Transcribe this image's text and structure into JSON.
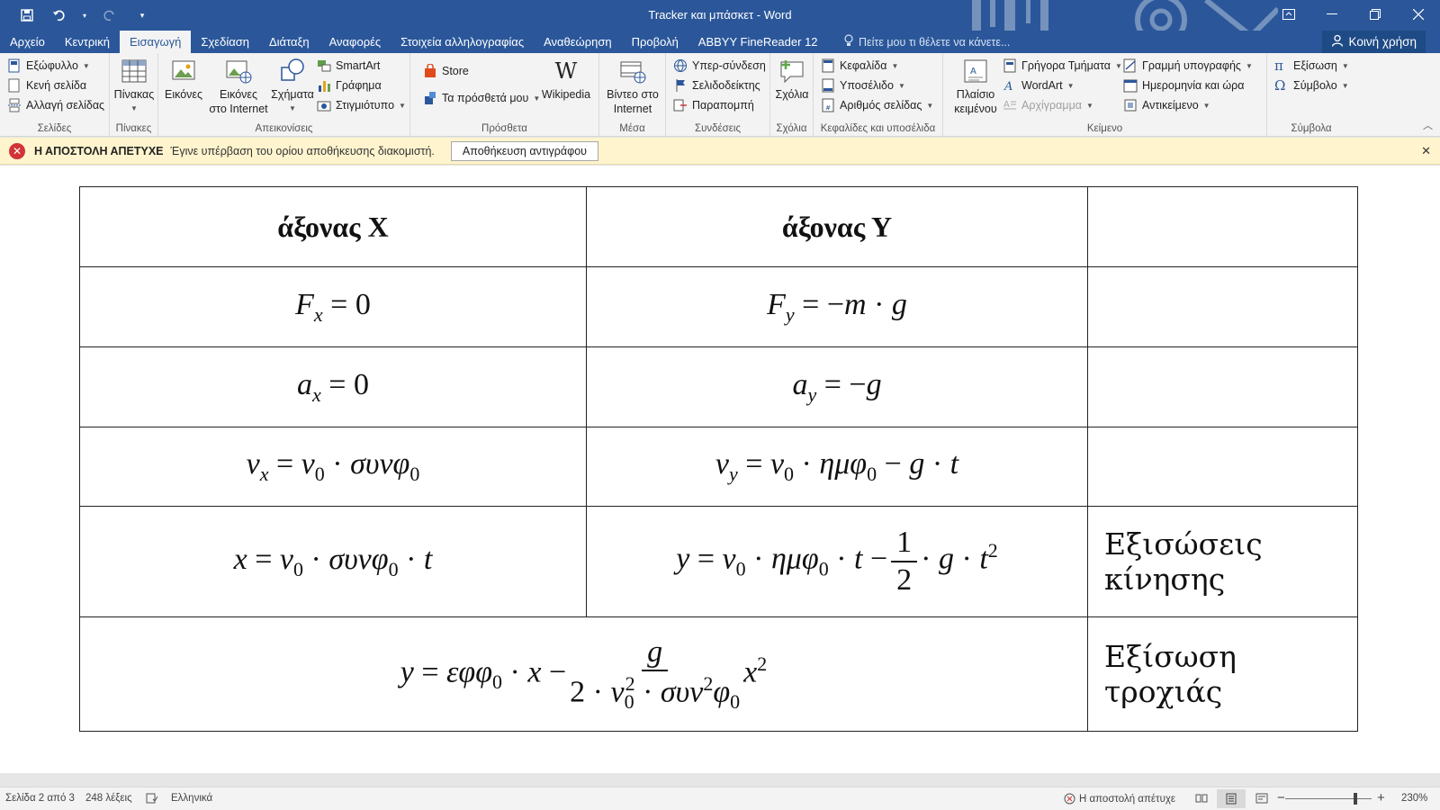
{
  "window": {
    "title": "Tracker και μπάσκετ - Word",
    "qat": [
      "save-icon",
      "undo-icon",
      "redo-icon",
      "customize-icon"
    ],
    "controls": [
      "ribbon-display-icon",
      "minimize-icon",
      "restore-icon",
      "close-icon"
    ]
  },
  "tabs": [
    "Αρχείο",
    "Κεντρική",
    "Εισαγωγή",
    "Σχεδίαση",
    "Διάταξη",
    "Αναφορές",
    "Στοιχεία αλληλογραφίας",
    "Αναθεώρηση",
    "Προβολή",
    "ABBYY FineReader 12"
  ],
  "active_tab": "Εισαγωγή",
  "tell_me": "Πείτε μου τι θέλετε να κάνετε...",
  "share": "Κοινή χρήση",
  "ribbon": {
    "pages": {
      "label": "Σελίδες",
      "items": [
        "Εξώφυλλο",
        "Κενή σελίδα",
        "Αλλαγή σελίδας"
      ]
    },
    "tables": {
      "label": "Πίνακες",
      "item": "Πίνακας"
    },
    "illustrations": {
      "label": "Απεικονίσεις",
      "pictures": "Εικόνες",
      "online_pictures_1": "Εικόνες",
      "online_pictures_2": "στο Internet",
      "shapes": "Σχήματα",
      "smartart": "SmartArt",
      "chart": "Γράφημα",
      "screenshot": "Στιγμιότυπο"
    },
    "addins": {
      "label": "Πρόσθετα",
      "store": "Store",
      "my_addins": "Τα πρόσθετά μου",
      "wikipedia": "Wikipedia"
    },
    "media": {
      "label": "Μέσα",
      "video_1": "Βίντεο στο",
      "video_2": "Internet"
    },
    "links": {
      "label": "Συνδέσεις",
      "items": [
        "Υπερ-σύνδεση",
        "Σελιδοδείκτης",
        "Παραπομπή"
      ]
    },
    "comments": {
      "label": "Σχόλια",
      "item": "Σχόλια"
    },
    "header_footer": {
      "label": "Κεφαλίδες και υποσέλιδα",
      "items": [
        "Κεφαλίδα",
        "Υποσέλιδο",
        "Αριθμός σελίδας"
      ]
    },
    "text": {
      "label": "Κείμενο",
      "textbox_1": "Πλαίσιο",
      "textbox_2": "κειμένου",
      "quick_parts": "Γρήγορα Τμήματα",
      "wordart": "WordArt",
      "dropcap": "Αρχίγραμμα",
      "signature_line": "Γραμμή υπογραφής",
      "date_time": "Ημερομηνία και ώρα",
      "object": "Αντικείμενο"
    },
    "symbols": {
      "label": "Σύμβολα",
      "equation": "Εξίσωση",
      "symbol": "Σύμβολο"
    }
  },
  "message_bar": {
    "title": "Η ΑΠΟΣΤΟΛΗ ΑΠΕΤΥΧΕ",
    "text": "Έγινε υπέρβαση του ορίου αποθήκευσης διακομιστή.",
    "button": "Αποθήκευση αντιγράφου"
  },
  "document": {
    "table": {
      "header": [
        "άξονας Χ",
        "άξονας Υ",
        ""
      ],
      "row_labels": {
        "motion": "Εξισώσεις κίνησης",
        "trajectory": "Εξίσωση τροχιάς"
      }
    }
  },
  "status": {
    "page": "Σελίδα 2 από 3",
    "words": "248 λέξεις",
    "language": "Ελληνικά",
    "upload": "Η αποστολή απέτυχε",
    "zoom": "230%"
  },
  "colors": {
    "brand": "#2b579a",
    "message_bg": "#fff4ce",
    "error": "#d13438"
  }
}
